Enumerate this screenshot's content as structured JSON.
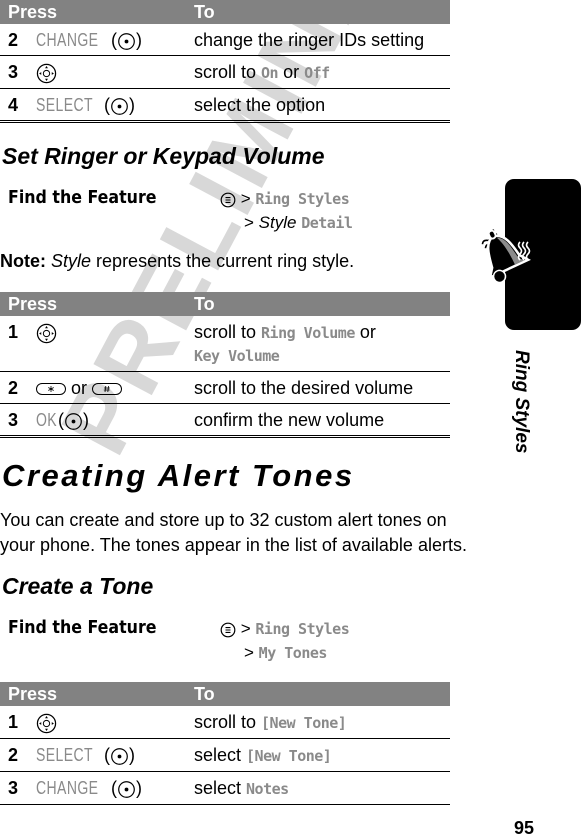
{
  "watermark": "PRELIMINARY",
  "page_number": "95",
  "side_tab": {
    "label": "Ring Styles",
    "icon": "ringing-bell-icon"
  },
  "table_headers": {
    "press": "Press",
    "to": "To"
  },
  "table1": {
    "rows": [
      {
        "num": "2",
        "press": {
          "softkey": "CHANGE",
          "key_icon": "center-select-key-icon"
        },
        "to": [
          {
            "text": "change the ringer IDs setting"
          }
        ]
      },
      {
        "num": "3",
        "press": {
          "key_icon": "navigation-key-icon"
        },
        "to": [
          {
            "text": "scroll to "
          },
          {
            "disp": "On"
          },
          {
            "text": " or "
          },
          {
            "disp": "Off"
          }
        ]
      },
      {
        "num": "4",
        "press": {
          "softkey": "SELECT",
          "key_icon": "center-select-key-icon"
        },
        "to": [
          {
            "text": "select the option"
          }
        ]
      }
    ]
  },
  "section_volume": {
    "title": "Set Ringer or Keypad Volume",
    "find_feature": {
      "label": "Find the Feature",
      "menu_icon": "menu-key-icon",
      "path_line1": "Ring Styles",
      "path_line2_italic": "Style",
      "path_line2": "Detail"
    },
    "note_label": "Note:",
    "note_italic": "Style",
    "note_text": " represents the current ring style.",
    "rows": [
      {
        "num": "1",
        "key_icon": "navigation-key-icon",
        "to_prefix": "scroll to ",
        "to_disp1": "Ring Volume",
        "to_mid": " or",
        "to_disp2": "Key Volume"
      },
      {
        "num": "2",
        "key_icon_1": "star-key-icon",
        "or": "or",
        "key_icon_2": "pound-key-icon",
        "to": "scroll to the desired volume"
      },
      {
        "num": "3",
        "softkey": "OK",
        "key_icon": "center-select-key-icon",
        "to": "confirm the new volume"
      }
    ]
  },
  "section_alert": {
    "title": "Creating Alert Tones",
    "paragraph": "You can create and store up to 32 custom alert tones on your phone. The tones appear in the list of available alerts.",
    "subtitle": "Create a Tone",
    "find_feature": {
      "label": "Find the Feature",
      "menu_icon": "menu-key-icon",
      "path_line1": "Ring Styles",
      "path_line2": "My Tones"
    },
    "rows": [
      {
        "num": "1",
        "key_icon": "navigation-key-icon",
        "to_prefix": "scroll to ",
        "to_disp": "[New Tone]"
      },
      {
        "num": "2",
        "softkey": "SELECT",
        "key_icon": "center-select-key-icon",
        "to_prefix": "select ",
        "to_disp": "[New Tone]"
      },
      {
        "num": "3",
        "softkey": "CHANGE",
        "key_icon": "center-select-key-icon",
        "to_prefix": "select ",
        "to_disp": "Notes"
      }
    ]
  },
  "symbols": {
    "gt": ">",
    "open_paren": "(",
    "close_paren": ")"
  }
}
